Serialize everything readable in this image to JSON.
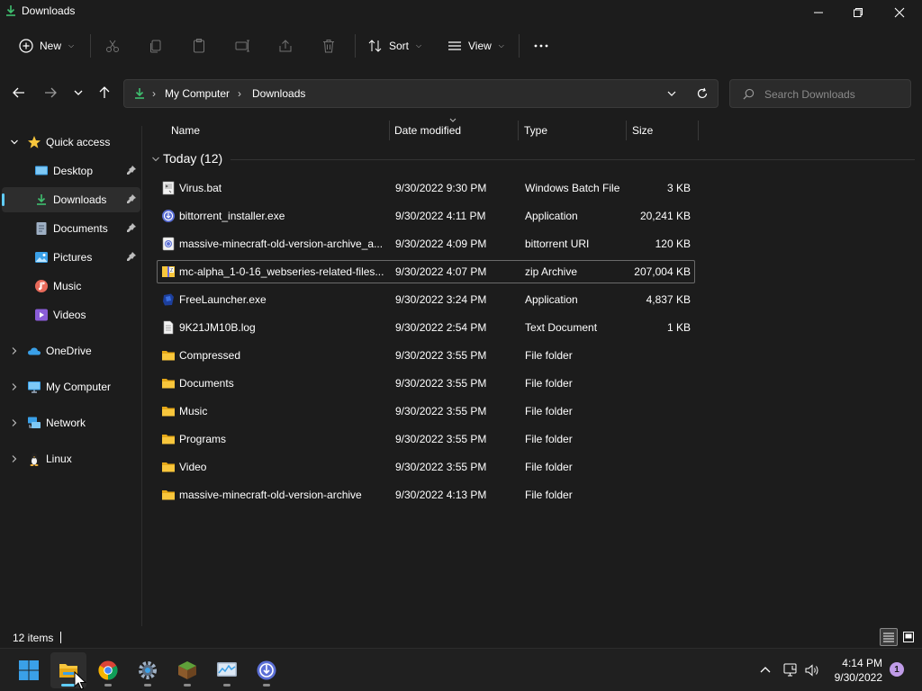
{
  "window": {
    "title": "Downloads"
  },
  "toolbar": {
    "new_label": "New",
    "sort_label": "Sort",
    "view_label": "View"
  },
  "address": {
    "segments": [
      "My Computer",
      "Downloads"
    ]
  },
  "search": {
    "placeholder": "Search Downloads"
  },
  "sidebar": {
    "items": [
      {
        "label": "Quick access"
      },
      {
        "label": "Desktop"
      },
      {
        "label": "Downloads"
      },
      {
        "label": "Documents"
      },
      {
        "label": "Pictures"
      },
      {
        "label": "Music"
      },
      {
        "label": "Videos"
      },
      {
        "label": "OneDrive"
      },
      {
        "label": "My Computer"
      },
      {
        "label": "Network"
      },
      {
        "label": "Linux"
      }
    ]
  },
  "columns": {
    "name": "Name",
    "date": "Date modified",
    "type": "Type",
    "size": "Size"
  },
  "group": {
    "label": "Today (12)"
  },
  "files": [
    {
      "name": "Virus.bat",
      "date": "9/30/2022 9:30 PM",
      "type": "Windows Batch File",
      "size": "3 KB",
      "icon": "batch-file-icon"
    },
    {
      "name": "bittorrent_installer.exe",
      "date": "9/30/2022 4:11 PM",
      "type": "Application",
      "size": "20,241 KB",
      "icon": "bittorrent-icon"
    },
    {
      "name": "massive-minecraft-old-version-archive_a...",
      "date": "9/30/2022 4:09 PM",
      "type": "bittorrent URI",
      "size": "120 KB",
      "icon": "torrent-file-icon"
    },
    {
      "name": "mc-alpha_1-0-16_webseries-related-files...",
      "date": "9/30/2022 4:07 PM",
      "type": "zip Archive",
      "size": "207,004 KB",
      "icon": "zip-archive-icon"
    },
    {
      "name": "FreeLauncher.exe",
      "date": "9/30/2022 3:24 PM",
      "type": "Application",
      "size": "4,837 KB",
      "icon": "application-icon"
    },
    {
      "name": "9K21JM10B.log",
      "date": "9/30/2022 2:54 PM",
      "type": "Text Document",
      "size": "1 KB",
      "icon": "text-document-icon"
    },
    {
      "name": "Compressed",
      "date": "9/30/2022 3:55 PM",
      "type": "File folder",
      "size": "",
      "icon": "folder-icon"
    },
    {
      "name": "Documents",
      "date": "9/30/2022 3:55 PM",
      "type": "File folder",
      "size": "",
      "icon": "folder-icon"
    },
    {
      "name": "Music",
      "date": "9/30/2022 3:55 PM",
      "type": "File folder",
      "size": "",
      "icon": "folder-icon"
    },
    {
      "name": "Programs",
      "date": "9/30/2022 3:55 PM",
      "type": "File folder",
      "size": "",
      "icon": "folder-icon"
    },
    {
      "name": "Video",
      "date": "9/30/2022 3:55 PM",
      "type": "File folder",
      "size": "",
      "icon": "folder-icon"
    },
    {
      "name": "massive-minecraft-old-version-archive",
      "date": "9/30/2022 4:13 PM",
      "type": "File folder",
      "size": "",
      "icon": "folder-icon"
    }
  ],
  "status": {
    "item_count": "12 items"
  },
  "taskbar": {
    "time": "4:14 PM",
    "date": "9/30/2022",
    "notifications": "1"
  },
  "colors": {
    "accent": "#60cdff",
    "folder": "#f8c63c",
    "background": "#1c1c1c"
  }
}
